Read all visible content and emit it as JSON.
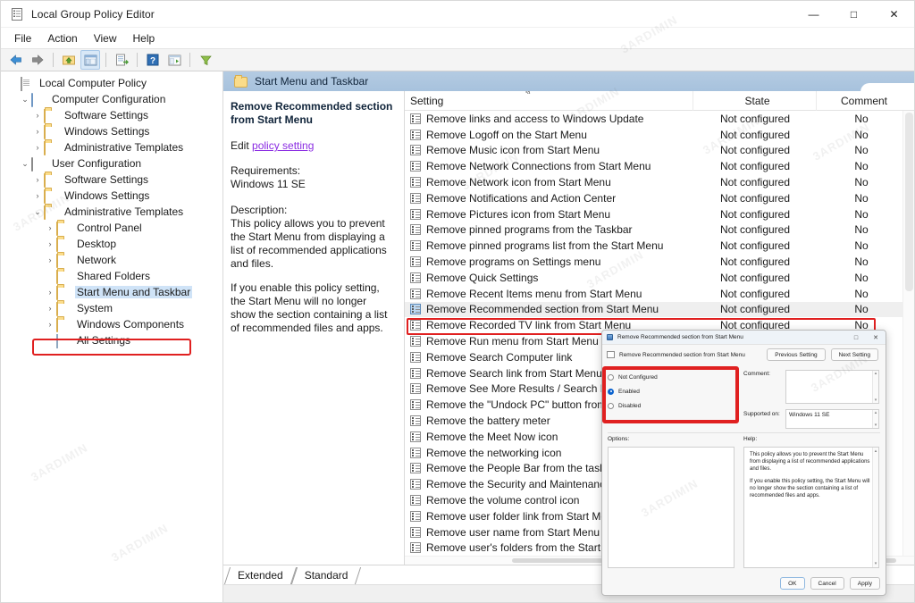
{
  "window": {
    "title": "Local Group Policy Editor",
    "icon": "policy-editor-icon",
    "minimize": "—",
    "maximize": "□",
    "close": "✕"
  },
  "menubar": {
    "items": [
      "File",
      "Action",
      "View",
      "Help"
    ]
  },
  "toolbar": {
    "buttons": [
      {
        "name": "back-icon",
        "glyph": "⬅"
      },
      {
        "name": "forward-icon",
        "glyph": "➡"
      },
      {
        "name": "up-folder-icon",
        "glyph": "⬆"
      },
      {
        "name": "show-hide-console-tree-icon",
        "glyph": "▤"
      },
      {
        "name": "export-list-icon",
        "glyph": "⤓"
      },
      {
        "name": "help-icon",
        "glyph": "?"
      },
      {
        "name": "properties-icon",
        "glyph": "▥"
      },
      {
        "name": "filter-icon",
        "glyph": "▽"
      }
    ]
  },
  "tree": {
    "items": [
      {
        "label": "Local Computer Policy",
        "indent": 0,
        "expander": "",
        "icon": "document-icon",
        "selected": false
      },
      {
        "label": "Computer Configuration",
        "indent": 1,
        "expander": "⌄",
        "icon": "computer-icon",
        "selected": false
      },
      {
        "label": "Software Settings",
        "indent": 2,
        "expander": "›",
        "icon": "folder-icon",
        "selected": false
      },
      {
        "label": "Windows Settings",
        "indent": 2,
        "expander": "›",
        "icon": "folder-icon",
        "selected": false
      },
      {
        "label": "Administrative Templates",
        "indent": 2,
        "expander": "›",
        "icon": "folder-icon",
        "selected": false
      },
      {
        "label": "User Configuration",
        "indent": 1,
        "expander": "⌄",
        "icon": "user-icon",
        "selected": false
      },
      {
        "label": "Software Settings",
        "indent": 2,
        "expander": "›",
        "icon": "folder-icon",
        "selected": false
      },
      {
        "label": "Windows Settings",
        "indent": 2,
        "expander": "›",
        "icon": "folder-icon",
        "selected": false
      },
      {
        "label": "Administrative Templates",
        "indent": 2,
        "expander": "⌄",
        "icon": "folder-icon",
        "selected": false
      },
      {
        "label": "Control Panel",
        "indent": 3,
        "expander": "›",
        "icon": "folder-icon",
        "selected": false
      },
      {
        "label": "Desktop",
        "indent": 3,
        "expander": "›",
        "icon": "folder-icon",
        "selected": false
      },
      {
        "label": "Network",
        "indent": 3,
        "expander": "›",
        "icon": "folder-icon",
        "selected": false
      },
      {
        "label": "Shared Folders",
        "indent": 3,
        "expander": "",
        "icon": "folder-icon",
        "selected": false
      },
      {
        "label": "Start Menu and Taskbar",
        "indent": 3,
        "expander": "›",
        "icon": "folder-icon",
        "selected": true
      },
      {
        "label": "System",
        "indent": 3,
        "expander": "›",
        "icon": "folder-icon",
        "selected": false
      },
      {
        "label": "Windows Components",
        "indent": 3,
        "expander": "›",
        "icon": "folder-icon",
        "selected": false
      },
      {
        "label": "All Settings",
        "indent": 3,
        "expander": "",
        "icon": "all-settings-icon",
        "selected": false
      }
    ],
    "highlight_index": 13,
    "highlight_color": "#e02020"
  },
  "path_bar": {
    "label": "Start Menu and Taskbar",
    "icon": "folder-icon"
  },
  "description": {
    "title": "Remove Recommended section from Start Menu",
    "edit_prefix": "Edit ",
    "edit_link": "policy setting",
    "requirements_label": "Requirements:",
    "requirements_value": "Windows 11 SE",
    "description_label": "Description:",
    "description_p1": "This policy allows you to prevent the Start Menu from displaying a list of recommended applications and files.",
    "description_p2": "If you enable this policy setting, the Start Menu will no longer show the section containing a list of recommended files and apps."
  },
  "list": {
    "columns": [
      "Setting",
      "State",
      "Comment"
    ],
    "sort_indicator": "ⱏ",
    "selected_index": 12,
    "highlight_color": "#e02020",
    "rows": [
      {
        "setting": "Remove links and access to Windows Update",
        "state": "Not configured",
        "comment": "No"
      },
      {
        "setting": "Remove Logoff on the Start Menu",
        "state": "Not configured",
        "comment": "No"
      },
      {
        "setting": "Remove Music icon from Start Menu",
        "state": "Not configured",
        "comment": "No"
      },
      {
        "setting": "Remove Network Connections from Start Menu",
        "state": "Not configured",
        "comment": "No"
      },
      {
        "setting": "Remove Network icon from Start Menu",
        "state": "Not configured",
        "comment": "No"
      },
      {
        "setting": "Remove Notifications and Action Center",
        "state": "Not configured",
        "comment": "No"
      },
      {
        "setting": "Remove Pictures icon from Start Menu",
        "state": "Not configured",
        "comment": "No"
      },
      {
        "setting": "Remove pinned programs from the Taskbar",
        "state": "Not configured",
        "comment": "No"
      },
      {
        "setting": "Remove pinned programs list from the Start Menu",
        "state": "Not configured",
        "comment": "No"
      },
      {
        "setting": "Remove programs on Settings menu",
        "state": "Not configured",
        "comment": "No"
      },
      {
        "setting": "Remove Quick Settings",
        "state": "Not configured",
        "comment": "No"
      },
      {
        "setting": "Remove Recent Items menu from Start Menu",
        "state": "Not configured",
        "comment": "No"
      },
      {
        "setting": "Remove Recommended section from Start Menu",
        "state": "Not configured",
        "comment": "No"
      },
      {
        "setting": "Remove Recorded TV link from Start Menu",
        "state": "Not configured",
        "comment": "No"
      },
      {
        "setting": "Remove Run menu from Start Menu",
        "state": "",
        "comment": ""
      },
      {
        "setting": "Remove Search Computer link",
        "state": "",
        "comment": ""
      },
      {
        "setting": "Remove Search link from Start Menu",
        "state": "",
        "comment": ""
      },
      {
        "setting": "Remove See More Results / Search Everywhere link",
        "state": "",
        "comment": ""
      },
      {
        "setting": "Remove the \"Undock PC\" button from the Start Menu",
        "state": "",
        "comment": ""
      },
      {
        "setting": "Remove the battery meter",
        "state": "",
        "comment": ""
      },
      {
        "setting": "Remove the Meet Now icon",
        "state": "",
        "comment": ""
      },
      {
        "setting": "Remove the networking icon",
        "state": "",
        "comment": ""
      },
      {
        "setting": "Remove the People Bar from the taskbar",
        "state": "",
        "comment": ""
      },
      {
        "setting": "Remove the Security and Maintenance icon",
        "state": "",
        "comment": ""
      },
      {
        "setting": "Remove the volume control icon",
        "state": "",
        "comment": ""
      },
      {
        "setting": "Remove user folder link from Start Menu",
        "state": "",
        "comment": ""
      },
      {
        "setting": "Remove user name from Start Menu",
        "state": "",
        "comment": ""
      },
      {
        "setting": "Remove user's folders from the Start Menu",
        "state": "",
        "comment": ""
      }
    ]
  },
  "tabs": {
    "items": [
      "Extended",
      "Standard"
    ],
    "active": "Standard"
  },
  "dialog": {
    "title": "Remove Recommended section from Start Menu",
    "subtitle": "Remove Recommended section from Start Menu",
    "maximize": "□",
    "close": "✕",
    "previous_setting": "Previous Setting",
    "next_setting": "Next Setting",
    "radios": [
      {
        "label": "Not Configured",
        "selected": false
      },
      {
        "label": "Enabled",
        "selected": true
      },
      {
        "label": "Disabled",
        "selected": false
      }
    ],
    "comment_label": "Comment:",
    "comment_value": "",
    "supported_label": "Supported on:",
    "supported_value": "Windows 11 SE",
    "options_label": "Options:",
    "help_label": "Help:",
    "help_p1": "This policy allows you to prevent the Start Menu from displaying a list of recommended applications and files.",
    "help_p2": "If you enable this policy setting, the Start Menu will no longer show the section containing a list of recommended files and apps.",
    "ok": "OK",
    "cancel": "Cancel",
    "apply": "Apply",
    "highlight_color": "#e02020"
  },
  "watermark": {
    "text": "3ARDIMIN"
  }
}
